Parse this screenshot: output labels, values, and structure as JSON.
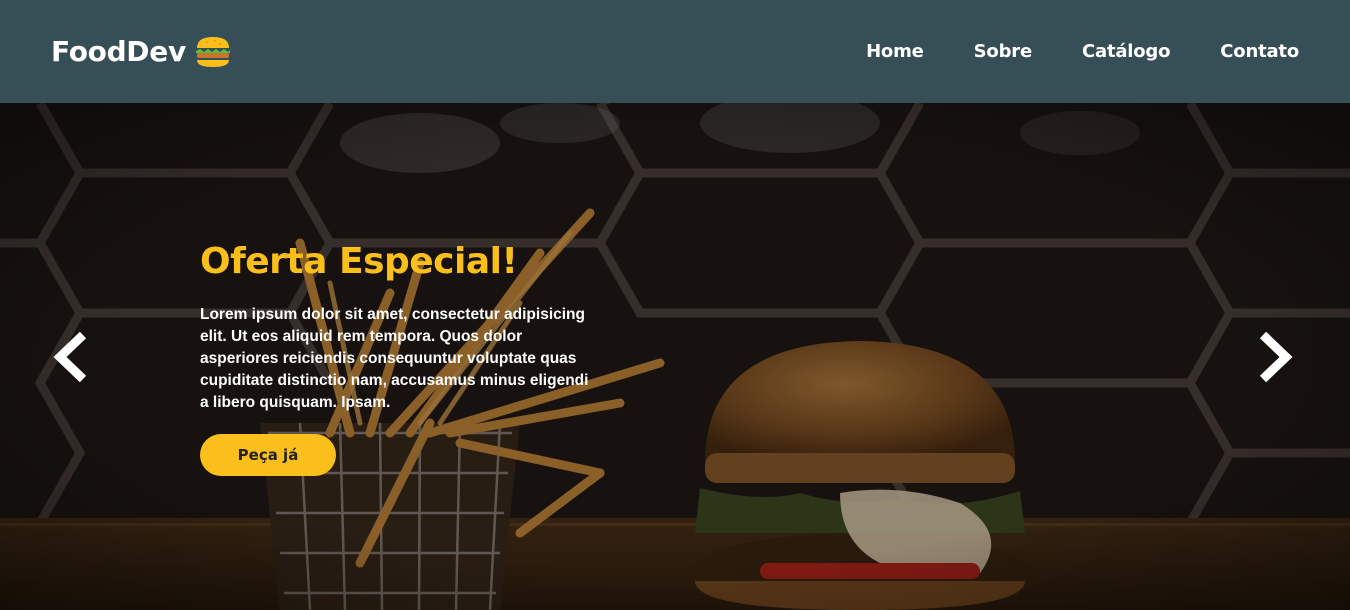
{
  "header": {
    "logo_text": "FoodDev",
    "logo_icon": "burger-icon",
    "nav": [
      {
        "label": "Home"
      },
      {
        "label": "Sobre"
      },
      {
        "label": "Catálogo"
      },
      {
        "label": "Contato"
      }
    ],
    "background_color": "#364e55"
  },
  "hero": {
    "title": "Oferta Especial!",
    "description": "Lorem ipsum dolor sit amet, consectetur adipisicing elit. Ut eos aliquid rem tempora. Quos dolor asperiores reiciendis consequuntur voluptate quas cupiditate distinctio nam, accusamus minus eligendi a libero quisquam. Ipsam.",
    "cta_label": "Peça já",
    "prev_icon": "chevron-left-icon",
    "next_icon": "chevron-right-icon",
    "accent_color": "#fbbf1c",
    "background_image": "burger-and-fries-photo"
  }
}
